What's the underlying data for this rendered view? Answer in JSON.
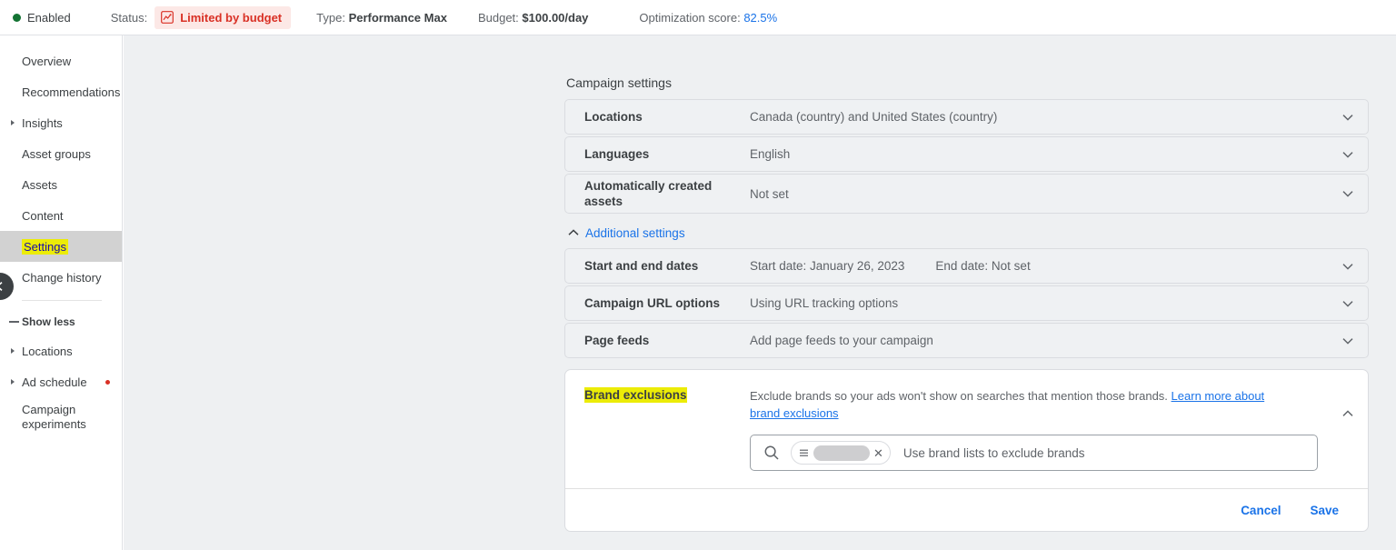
{
  "topbar": {
    "status_dot_color": "#137333",
    "enabled_label": "Enabled",
    "status_label": "Status:",
    "status_badge": "Limited by budget",
    "status_badge_bg": "#fce8e6",
    "status_badge_color": "#d93025",
    "type_label": "Type:",
    "type_value": "Performance Max",
    "budget_label": "Budget:",
    "budget_value": "$100.00/day",
    "optimization_label": "Optimization score:",
    "optimization_value": "82.5%",
    "optimization_color": "#1a73e8"
  },
  "sidebar": {
    "items": [
      {
        "label": "Overview",
        "expandable": false,
        "selected": false,
        "dot": false
      },
      {
        "label": "Recommendations",
        "expandable": false,
        "selected": false,
        "dot": false
      },
      {
        "label": "Insights",
        "expandable": true,
        "selected": false,
        "dot": false
      },
      {
        "label": "Asset groups",
        "expandable": false,
        "selected": false,
        "dot": false
      },
      {
        "label": "Assets",
        "expandable": false,
        "selected": false,
        "dot": false
      },
      {
        "label": "Content",
        "expandable": false,
        "selected": false,
        "dot": false
      },
      {
        "label": "Settings",
        "expandable": false,
        "selected": true,
        "dot": false
      },
      {
        "label": "Change history",
        "expandable": false,
        "selected": false,
        "dot": false
      }
    ],
    "show_less": "Show less",
    "sub_items": [
      {
        "label": "Locations",
        "expandable": true,
        "dot": false
      },
      {
        "label": "Ad schedule",
        "expandable": true,
        "dot": true
      },
      {
        "label": "Campaign experiments",
        "expandable": false,
        "dot": false
      }
    ],
    "collapse_icon": "chevron-left-icon",
    "highlight_color": "#ecec07"
  },
  "main": {
    "section_title": "Campaign settings",
    "settings_rows": [
      {
        "label": "Locations",
        "value": "Canada (country) and United States (country)",
        "value2": ""
      },
      {
        "label": "Languages",
        "value": "English",
        "value2": ""
      },
      {
        "label": "Automatically created assets",
        "value": "Not set",
        "value2": ""
      }
    ],
    "additional_settings_label": "Additional settings",
    "additional_rows": [
      {
        "label": "Start and end dates",
        "value": "Start date: January 26, 2023",
        "value2": "End date: Not set"
      },
      {
        "label": "Campaign URL options",
        "value": "Using URL tracking options",
        "value2": ""
      },
      {
        "label": "Page feeds",
        "value": "Add page feeds to your campaign",
        "value2": ""
      }
    ],
    "brand_exclusions": {
      "label": "Brand exclusions",
      "description": "Exclude brands so your ads won't show on searches that mention those brands.",
      "link_text": "Learn more about brand exclusions",
      "search_placeholder": "Use brand lists to exclude brands",
      "chip_value": "",
      "cancel_label": "Cancel",
      "save_label": "Save"
    }
  }
}
